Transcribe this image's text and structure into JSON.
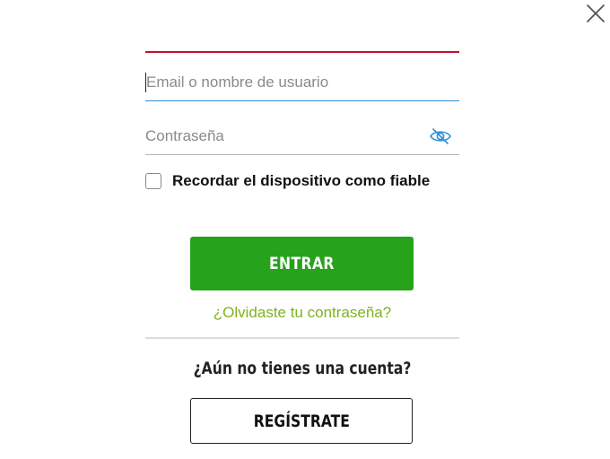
{
  "login": {
    "email_placeholder": "Email o nombre de usuario",
    "password_placeholder": "Contraseña",
    "remember_label": "Recordar el dispositivo como fiable",
    "submit_label": "ENTRAR",
    "forgot_label": "¿Olvidaste tu contraseña?"
  },
  "signup": {
    "prompt": "¿Aún no tienes una cuenta?",
    "register_label": "REGÍSTRATE"
  },
  "icons": {
    "close": "close-icon",
    "show_password": "eye-icon"
  },
  "colors": {
    "accent_red": "#c8102e",
    "primary_green": "#27a21b",
    "link_green": "#7fb21e",
    "focus_blue": "#2b8fd6"
  }
}
